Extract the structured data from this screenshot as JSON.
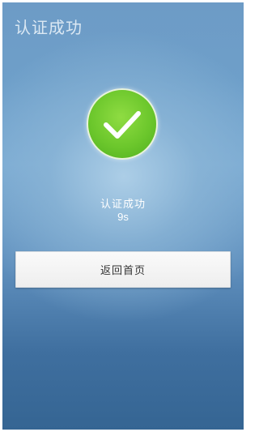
{
  "header": {
    "title": "认证成功"
  },
  "result": {
    "icon": "checkmark-icon",
    "status_text": "认证成功",
    "countdown": "9s",
    "accent_color": "#6cc72c"
  },
  "actions": {
    "home_button_label": "返回首页"
  }
}
